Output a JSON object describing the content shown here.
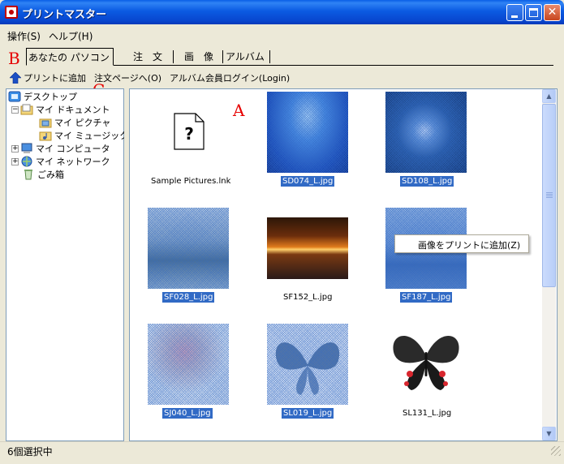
{
  "window": {
    "title": "プリントマスター"
  },
  "menu": {
    "items": [
      "操作(S)",
      "ヘルプ(H)"
    ]
  },
  "tabs": [
    "あなたの パソコン",
    "注　文",
    "画　像",
    "アルバム"
  ],
  "toolbar": {
    "add_to_print": "プリントに追加",
    "order_page": "注文ページへ(O)",
    "album_login": "アルバム会員ログイン(Login)"
  },
  "annotations": {
    "a": "A",
    "b": "B",
    "c": "C"
  },
  "tree": {
    "items": [
      "デスクトップ",
      "マイ ドキュメント",
      "マイ ピクチャ",
      "マイ ミュージック",
      "マイ コンピュータ",
      "マイ ネットワーク",
      "ごみ箱"
    ]
  },
  "files": [
    {
      "name": "Sample Pictures.lnk",
      "selected": false
    },
    {
      "name": "SD074_L.jpg",
      "selected": true
    },
    {
      "name": "SD108_L.jpg",
      "selected": true
    },
    {
      "name": "SF028_L.jpg",
      "selected": true
    },
    {
      "name": "SF152_L.jpg",
      "selected": false
    },
    {
      "name": "SF187_L.jpg",
      "selected": true
    },
    {
      "name": "SJ040_L.jpg",
      "selected": true
    },
    {
      "name": "SL019_L.jpg",
      "selected": true
    },
    {
      "name": "SL131_L.jpg",
      "selected": false
    }
  ],
  "context_menu": {
    "item": "画像をプリントに追加(Z)"
  },
  "status": {
    "text": "6個選択中"
  },
  "colors": {
    "selection": "#316ac5",
    "annotation": "#e60000",
    "titlebar": "#0a5fe6"
  }
}
